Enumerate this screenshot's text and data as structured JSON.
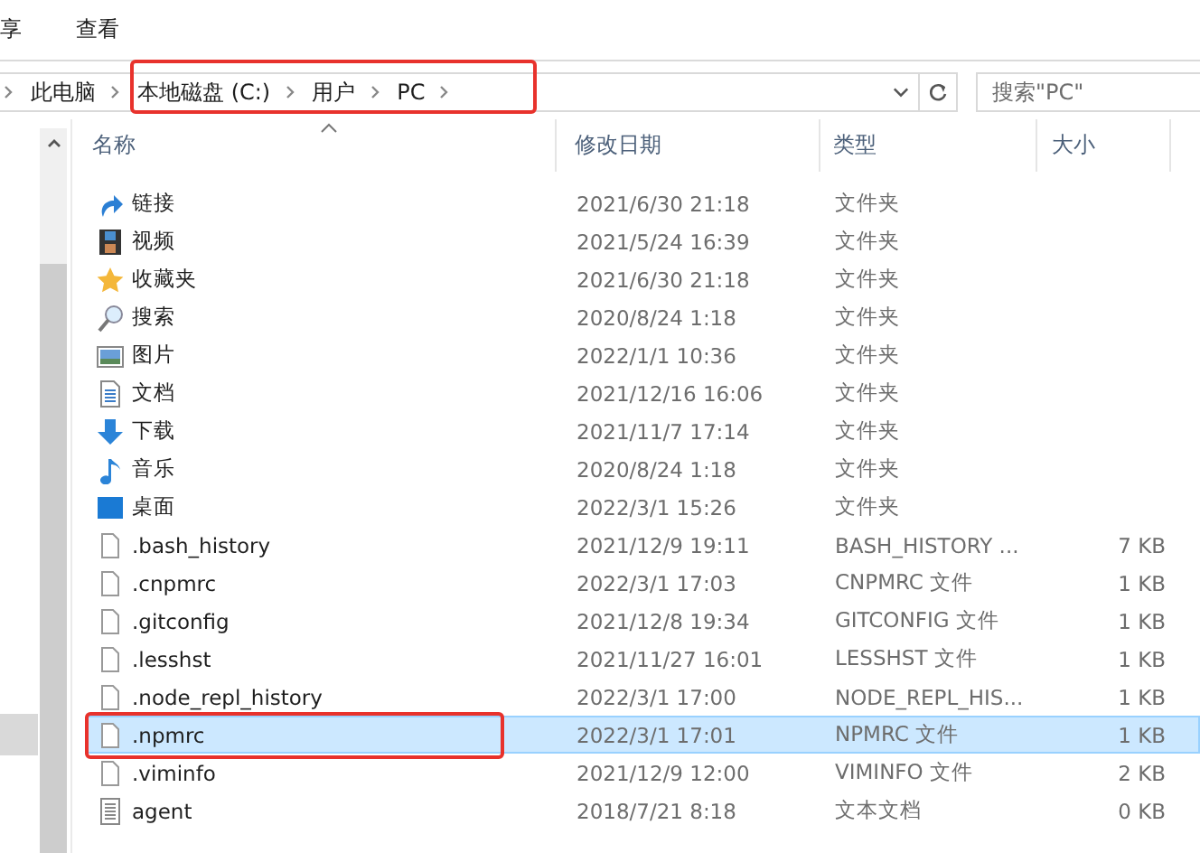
{
  "ribbon_tabs": [
    {
      "label": "享",
      "selected": false
    },
    {
      "label": "查看",
      "selected": false
    }
  ],
  "breadcrumb": [
    "此电脑",
    "本地磁盘 (C:)",
    "用户",
    "PC"
  ],
  "search": {
    "placeholder": "搜索\"PC\""
  },
  "table": {
    "columns": [
      "名称",
      "修改日期",
      "类型",
      "大小"
    ],
    "rows": [
      {
        "kind": "link",
        "name": "链接",
        "date": "2021/6/30 21:18",
        "type": "文件夹",
        "size": "",
        "selected": false
      },
      {
        "kind": "video",
        "name": "视频",
        "date": "2021/5/24 16:39",
        "type": "文件夹",
        "size": "",
        "selected": false
      },
      {
        "kind": "star",
        "name": "收藏夹",
        "date": "2021/6/30 21:18",
        "type": "文件夹",
        "size": "",
        "selected": false
      },
      {
        "kind": "search",
        "name": "搜索",
        "date": "2020/8/24 1:18",
        "type": "文件夹",
        "size": "",
        "selected": false
      },
      {
        "kind": "picture",
        "name": "图片",
        "date": "2022/1/1 10:36",
        "type": "文件夹",
        "size": "",
        "selected": false
      },
      {
        "kind": "document",
        "name": "文档",
        "date": "2021/12/16 16:06",
        "type": "文件夹",
        "size": "",
        "selected": false
      },
      {
        "kind": "download",
        "name": "下载",
        "date": "2021/11/7 17:14",
        "type": "文件夹",
        "size": "",
        "selected": false
      },
      {
        "kind": "music",
        "name": "音乐",
        "date": "2020/8/24 1:18",
        "type": "文件夹",
        "size": "",
        "selected": false
      },
      {
        "kind": "desktop",
        "name": "桌面",
        "date": "2022/3/1 15:26",
        "type": "文件夹",
        "size": "",
        "selected": false
      },
      {
        "kind": "file",
        "name": ".bash_history",
        "date": "2021/12/9 19:11",
        "type": "BASH_HISTORY ...",
        "size": "7 KB",
        "selected": false
      },
      {
        "kind": "file",
        "name": ".cnpmrc",
        "date": "2022/3/1 17:03",
        "type": "CNPMRC 文件",
        "size": "1 KB",
        "selected": false
      },
      {
        "kind": "file",
        "name": ".gitconfig",
        "date": "2021/12/8 19:34",
        "type": "GITCONFIG 文件",
        "size": "1 KB",
        "selected": false
      },
      {
        "kind": "file",
        "name": ".lesshst",
        "date": "2021/11/27 16:01",
        "type": "LESSHST 文件",
        "size": "1 KB",
        "selected": false
      },
      {
        "kind": "file",
        "name": ".node_repl_history",
        "date": "2022/3/1 17:00",
        "type": "NODE_REPL_HIS...",
        "size": "1 KB",
        "selected": false
      },
      {
        "kind": "file",
        "name": ".npmrc",
        "date": "2022/3/1 17:01",
        "type": "NPMRC 文件",
        "size": "1 KB",
        "selected": true
      },
      {
        "kind": "file",
        "name": ".viminfo",
        "date": "2021/12/9 12:00",
        "type": "VIMINFO 文件",
        "size": "2 KB",
        "selected": false
      },
      {
        "kind": "text",
        "name": "agent",
        "date": "2018/7/21 8:18",
        "type": "文本文档",
        "size": "0 KB",
        "selected": false
      }
    ]
  }
}
